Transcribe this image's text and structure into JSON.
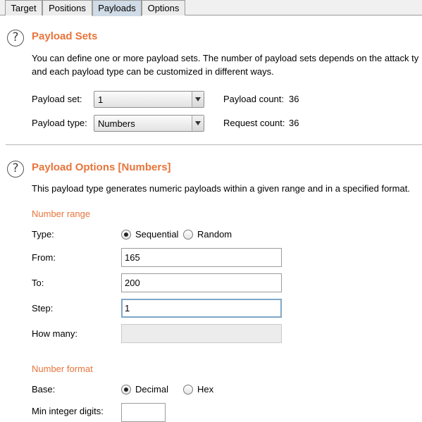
{
  "tabs": [
    {
      "label": "Target"
    },
    {
      "label": "Positions"
    },
    {
      "label": "Payloads"
    },
    {
      "label": "Options"
    }
  ],
  "active_tab": "Payloads",
  "payload_sets": {
    "title": "Payload Sets",
    "description_line1": "You can define one or more payload sets. The number of payload sets depends on the attack ty",
    "description_line2": "and each payload type can be customized in different ways.",
    "payload_set_label": "Payload set:",
    "payload_set_value": "1",
    "payload_type_label": "Payload type:",
    "payload_type_value": "Numbers",
    "payload_count_label": "Payload count:",
    "payload_count_value": "36",
    "request_count_label": "Request count:",
    "request_count_value": "36"
  },
  "payload_options": {
    "title": "Payload Options [Numbers]",
    "description": "This payload type generates numeric payloads within a given range and in a specified format.",
    "number_range_heading": "Number range",
    "type_label": "Type:",
    "type_options": [
      "Sequential",
      "Random"
    ],
    "type_selected": "Sequential",
    "from_label": "From:",
    "from_value": "165",
    "to_label": "To:",
    "to_value": "200",
    "step_label": "Step:",
    "step_value": "1",
    "how_many_label": "How many:",
    "how_many_value": "",
    "number_format_heading": "Number format",
    "base_label": "Base:",
    "base_options": [
      "Decimal",
      "Hex"
    ],
    "base_selected": "Decimal",
    "min_integer_digits_label": "Min integer digits:"
  },
  "colors": {
    "heading": "#e8743b",
    "active_tab": "#cfdbe6",
    "focus_border": "#7fa7c9"
  },
  "icons": {
    "help": "question-circle"
  }
}
